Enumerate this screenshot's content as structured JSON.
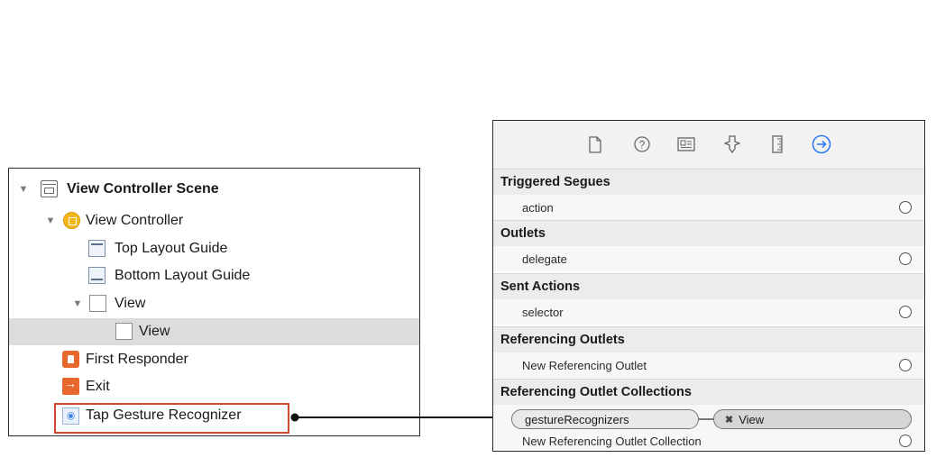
{
  "outline": {
    "items": [
      {
        "label": "View Controller Scene",
        "icon": "storyboard-scene-icon",
        "disclosure": "expanded"
      },
      {
        "label": "View Controller",
        "icon": "view-controller-icon",
        "disclosure": "expanded"
      },
      {
        "label": "Top Layout Guide",
        "icon": "top-layout-guide-icon"
      },
      {
        "label": "Bottom Layout Guide",
        "icon": "bottom-layout-guide-icon"
      },
      {
        "label": "View",
        "icon": "view-icon",
        "disclosure": "expanded"
      },
      {
        "label": "View",
        "icon": "view-icon",
        "selected": true
      },
      {
        "label": "First Responder",
        "icon": "first-responder-icon"
      },
      {
        "label": "Exit",
        "icon": "exit-icon"
      },
      {
        "label": "Tap Gesture Recognizer",
        "icon": "tap-gesture-icon",
        "highlighted": true
      }
    ]
  },
  "inspector": {
    "toolbar": [
      "file-inspector-icon",
      "quick-help-icon",
      "identity-inspector-icon",
      "attributes-inspector-icon",
      "size-inspector-icon",
      "connections-inspector-icon"
    ],
    "active_tab": "connections-inspector-icon",
    "accent_color": "#2f7cf6",
    "sections": [
      {
        "title": "Triggered Segues",
        "rows": [
          {
            "label": "action",
            "connected": false
          }
        ]
      },
      {
        "title": "Outlets",
        "rows": [
          {
            "label": "delegate",
            "connected": false
          }
        ]
      },
      {
        "title": "Sent Actions",
        "rows": [
          {
            "label": "selector",
            "connected": false
          }
        ]
      },
      {
        "title": "Referencing Outlets",
        "rows": [
          {
            "label": "New Referencing Outlet",
            "connected": false
          }
        ]
      },
      {
        "title": "Referencing Outlet Collections",
        "rows": [
          {
            "label": "gestureRecognizers",
            "target": "View",
            "connected": true
          },
          {
            "label": "New Referencing Outlet Collection",
            "connected": false
          }
        ]
      }
    ]
  },
  "colors": {
    "highlight_border": "#cf4a2c",
    "selection_bg": "#dcdcdc"
  }
}
